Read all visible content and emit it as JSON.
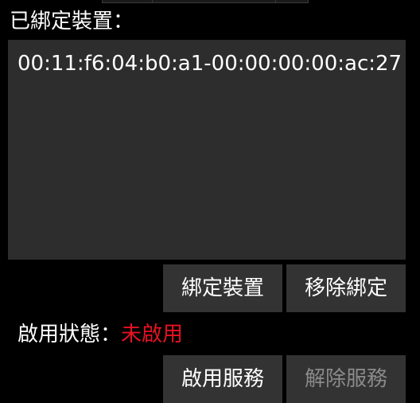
{
  "bound_devices": {
    "label": "已綁定裝置：",
    "items": [
      "00:11:f6:04:b0:a1-00:00:00:00:ac:27"
    ]
  },
  "buttons": {
    "bind": "綁定裝置",
    "remove": "移除綁定",
    "enable_service": "啟用服務",
    "disable_service": "解除服務"
  },
  "status": {
    "label": "啟用狀態：",
    "value": "未啟用",
    "value_color": "#e81123"
  },
  "colors": {
    "background": "#000000",
    "panel": "#2d2d2d",
    "button": "#333333",
    "disabled_text": "#8a8a8a"
  }
}
